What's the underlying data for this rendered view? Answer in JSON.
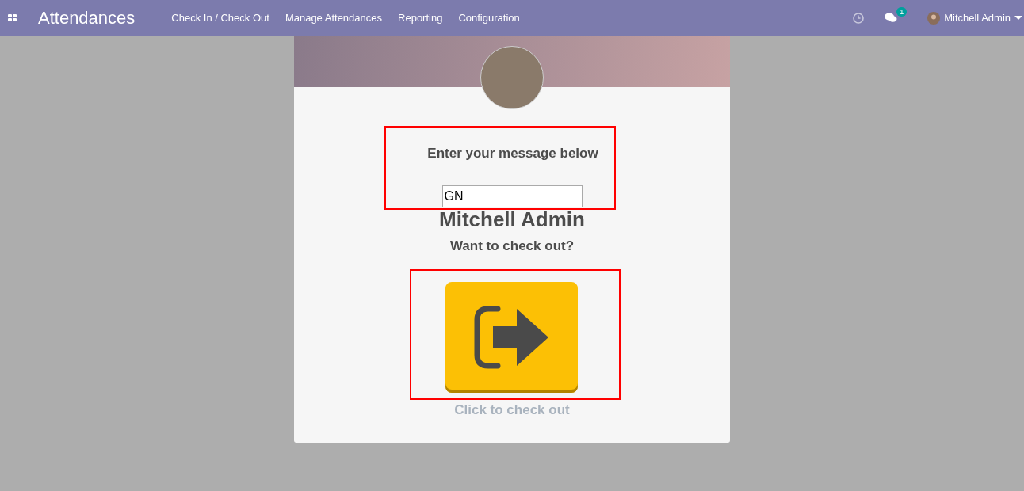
{
  "navbar": {
    "app_title": "Attendances",
    "menu": [
      {
        "label": "Check In / Check Out"
      },
      {
        "label": "Manage Attendances"
      },
      {
        "label": "Reporting"
      },
      {
        "label": "Configuration"
      }
    ],
    "messages_badge": "1",
    "user_name": "Mitchell Admin"
  },
  "card": {
    "prompt": "Enter your message below",
    "message_value": "GN",
    "employee_name": "Mitchell Admin",
    "question": "Want to check out?",
    "action_caption": "Click to check out"
  }
}
